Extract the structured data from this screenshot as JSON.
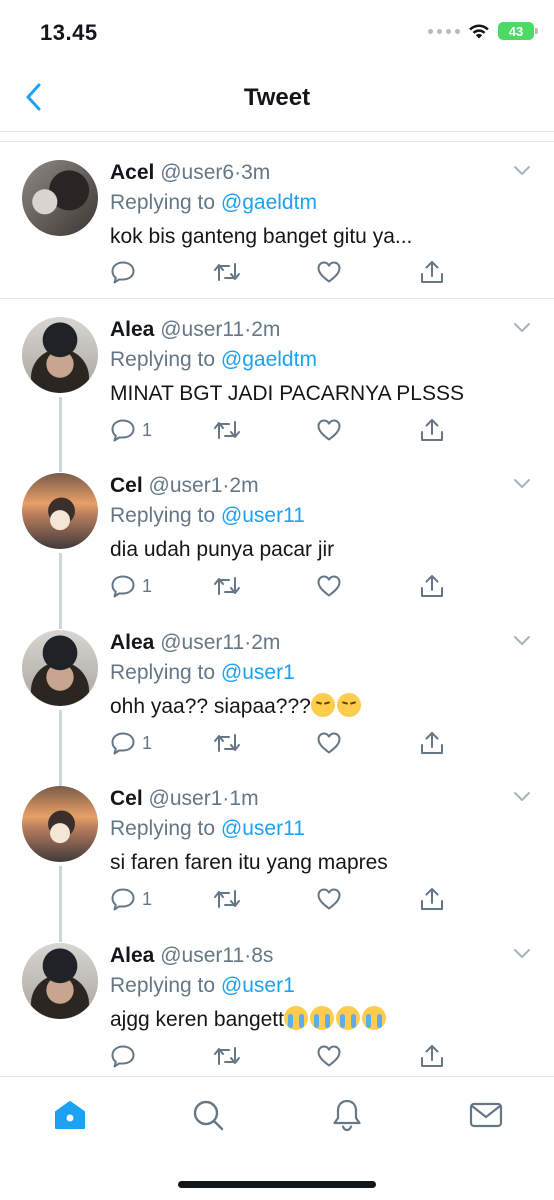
{
  "status_bar": {
    "time": "13.45",
    "battery": "43"
  },
  "header": {
    "title": "Tweet"
  },
  "tweets": [
    {
      "name": "Acel",
      "handle": "@user6",
      "dot": "·",
      "time": "3m",
      "replying_prefix": "Replying to",
      "replying_to": "@gaeldtm",
      "text": "kok bis ganteng banget gitu ya...",
      "reply_count": ""
    },
    {
      "name": "Alea",
      "handle": "@user11",
      "dot": "·",
      "time": "2m",
      "replying_prefix": "Replying to",
      "replying_to": "@gaeldtm",
      "text": "MINAT BGT JADI PACARNYA PLSSS",
      "reply_count": "1"
    },
    {
      "name": "Cel",
      "handle": "@user1",
      "dot": "·",
      "time": "2m",
      "replying_prefix": "Replying to",
      "replying_to": "@user11",
      "text": "dia udah punya pacar jir",
      "reply_count": "1"
    },
    {
      "name": "Alea",
      "handle": "@user11",
      "dot": "·",
      "time": "2m",
      "replying_prefix": "Replying to",
      "replying_to": "@user1",
      "text": "ohh yaa?? siapaa???",
      "emoji": [
        "pensive-face",
        "pensive-face"
      ],
      "reply_count": "1"
    },
    {
      "name": "Cel",
      "handle": "@user1",
      "dot": "·",
      "time": "1m",
      "replying_prefix": "Replying to",
      "replying_to": "@user11",
      "text": "si faren faren itu yang mapres",
      "reply_count": "1"
    },
    {
      "name": "Alea",
      "handle": "@user11",
      "dot": "·",
      "time": "8s",
      "replying_prefix": "Replying to",
      "replying_to": "@user1",
      "text": "ajgg keren bangett",
      "emoji": [
        "loudly-crying-face",
        "loudly-crying-face",
        "loudly-crying-face",
        "loudly-crying-face"
      ],
      "reply_count": ""
    }
  ],
  "tab_bar": {
    "items": [
      "home-icon",
      "search-icon",
      "notifications-icon",
      "messages-icon"
    ],
    "active_color": "#1da1f2"
  },
  "colors": {
    "accent": "#1da1f2",
    "secondary_text": "#657786",
    "battery": "#4cd964"
  }
}
